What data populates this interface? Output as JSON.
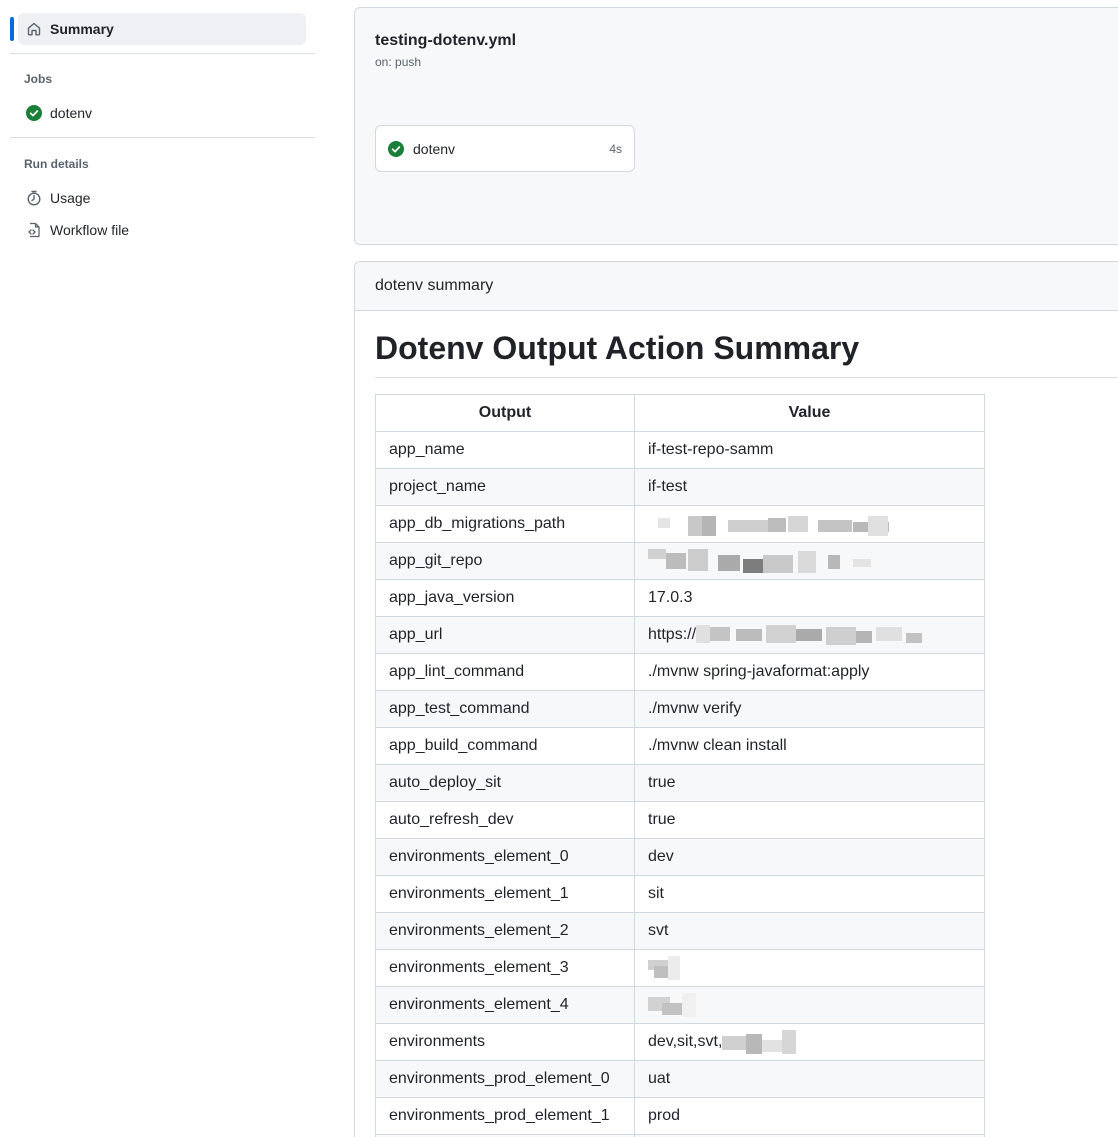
{
  "sidebar": {
    "summary_label": "Summary",
    "jobs_heading": "Jobs",
    "jobs": [
      {
        "label": "dotenv",
        "status": "success"
      }
    ],
    "run_details_heading": "Run details",
    "run_details": [
      {
        "label": "Usage",
        "icon": "stopwatch-icon"
      },
      {
        "label": "Workflow file",
        "icon": "file-code-icon"
      }
    ]
  },
  "workflow": {
    "file": "testing-dotenv.yml",
    "trigger": "on: push",
    "job": {
      "name": "dotenv",
      "duration": "4s",
      "status": "success"
    }
  },
  "summary": {
    "header": "dotenv summary",
    "title": "Dotenv Output Action Summary",
    "columns": [
      "Output",
      "Value"
    ],
    "rows": [
      {
        "key": "app_name",
        "value": "if-test-repo-samm"
      },
      {
        "key": "project_name",
        "value": "if-test"
      },
      {
        "key": "app_db_migrations_path",
        "value": ""
      },
      {
        "key": "app_git_repo",
        "value": ""
      },
      {
        "key": "app_java_version",
        "value": "17.0.3"
      },
      {
        "key": "app_url",
        "value": "https://"
      },
      {
        "key": "app_lint_command",
        "value": "./mvnw spring-javaformat:apply"
      },
      {
        "key": "app_test_command",
        "value": "./mvnw verify"
      },
      {
        "key": "app_build_command",
        "value": "./mvnw clean install"
      },
      {
        "key": "auto_deploy_sit",
        "value": "true"
      },
      {
        "key": "auto_refresh_dev",
        "value": "true"
      },
      {
        "key": "environments_element_0",
        "value": "dev"
      },
      {
        "key": "environments_element_1",
        "value": "sit"
      },
      {
        "key": "environments_element_2",
        "value": "svt"
      },
      {
        "key": "environments_element_3",
        "value": ""
      },
      {
        "key": "environments_element_4",
        "value": ""
      },
      {
        "key": "environments",
        "value": "dev,sit,svt,"
      },
      {
        "key": "environments_prod_element_0",
        "value": "uat"
      },
      {
        "key": "environments_prod_element_1",
        "value": "prod"
      },
      {
        "key": "",
        "value": ""
      }
    ]
  },
  "colors": {
    "accent": "#0969da",
    "success": "#1a7f37",
    "border": "#d1d9e0",
    "muted": "#59636e"
  }
}
